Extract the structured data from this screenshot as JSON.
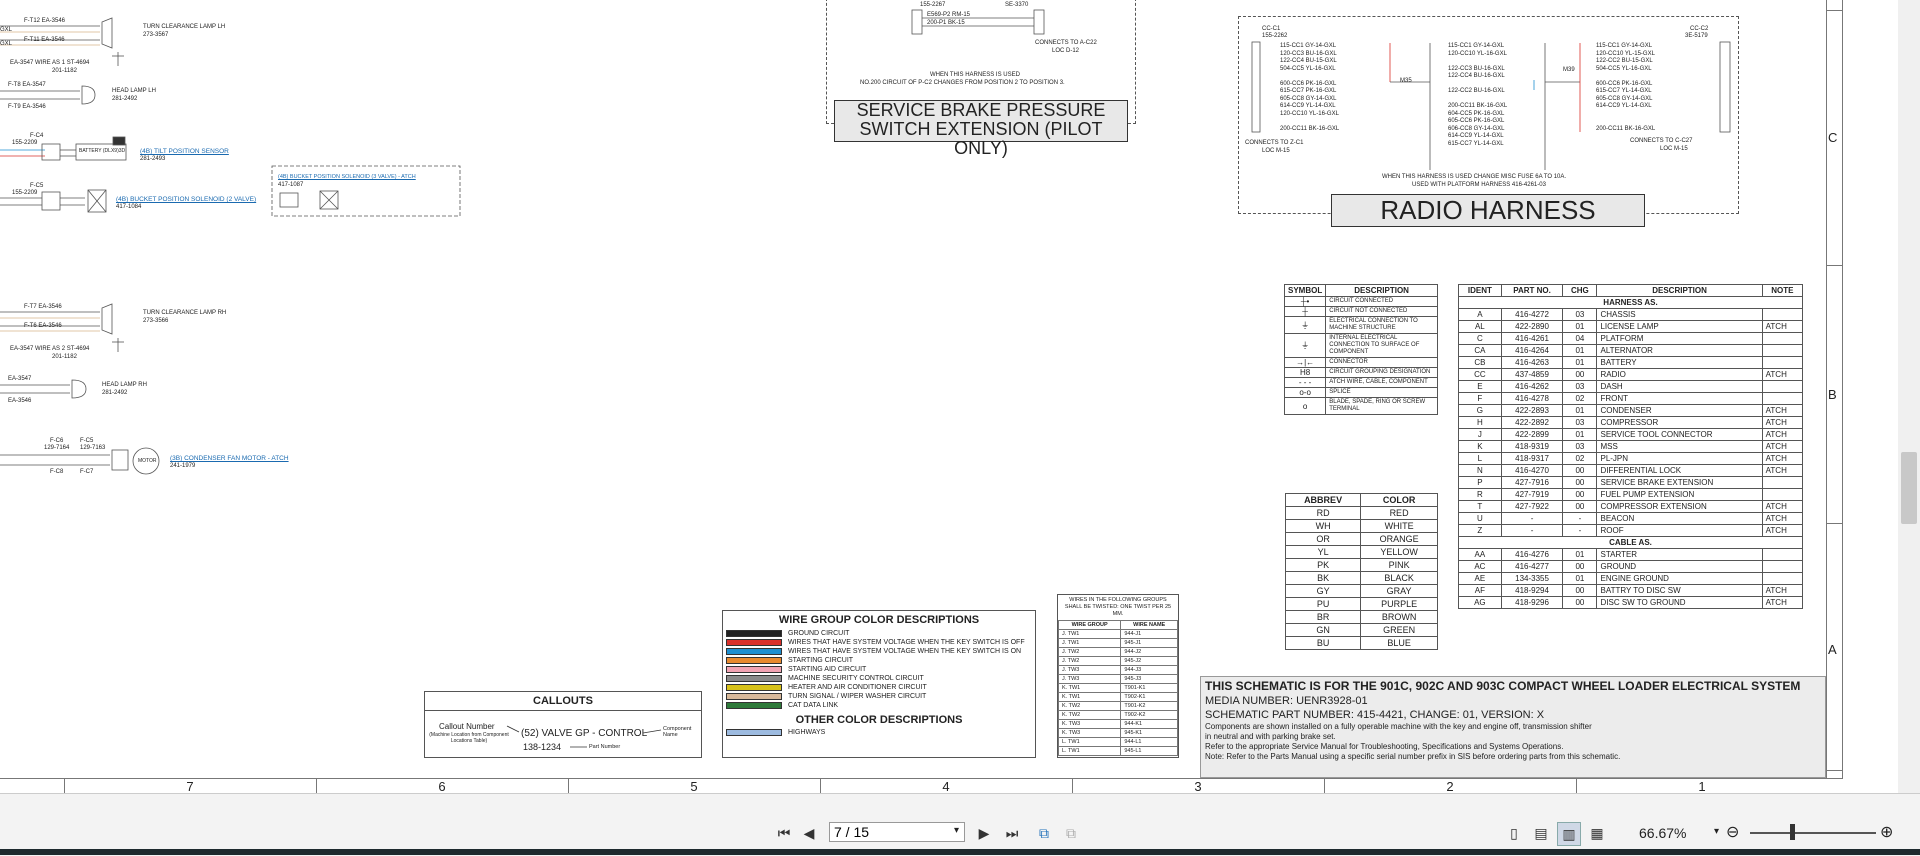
{
  "left_circuits": [
    {
      "id": "a1",
      "wires": [
        "F-T12 EA-3546",
        "F-T11 EA-3546"
      ],
      "left": [
        "GXL",
        "GXL"
      ],
      "under": "EA-3547  WIRE AS 1  ST-4694",
      "part": "201-1182",
      "lamp": "TURN CLEARANCE LAMP LH",
      "lamp_part": "273-3567"
    },
    {
      "id": "a2",
      "wires": [
        "F-T8 EA-3547",
        "F-T9 EA-3546"
      ],
      "lamp": "HEAD LAMP LH",
      "lamp_part": "281-2492"
    },
    {
      "id": "a3",
      "ref": "F-C4",
      "part": "155-2209",
      "box": "BATTERY (DLX9)3D",
      "link": "(4B) TILT POSITION SENSOR",
      "link_part": "281-2493"
    },
    {
      "id": "a4",
      "ref": "F-C5",
      "part": "155-2209",
      "link": "(4B) BUCKET POSITION SOLENOID (2 VALVE)",
      "link_part": "417-1084",
      "atch_title": "(4B) BUCKET POSITION SOLENOID (3 VALVE) - ATCH",
      "atch_part": "417-1087"
    },
    {
      "id": "a5",
      "wires": [
        "F-T7 EA-3546",
        "F-T6 EA-3546"
      ],
      "under": "EA-3547  WIRE AS 2  ST-4694",
      "part": "201-1182",
      "lamp": "TURN CLEARANCE LAMP RH",
      "lamp_part": "273-3566"
    },
    {
      "id": "a6",
      "wires": [
        "EA-3547",
        "EA-3546"
      ],
      "lamp": "HEAD LAMP RH",
      "lamp_part": "281-2492"
    },
    {
      "id": "a7",
      "refs": [
        "F-C6",
        "F-C5",
        "F-C8",
        "F-C7"
      ],
      "parts": [
        "129-7164",
        "129-7163"
      ],
      "link": "(3B) CONDENSER FAN MOTOR - ATCH",
      "link_part": "241-1979",
      "motor": "MOTOR"
    }
  ],
  "brake": {
    "top_parts": [
      "155-2267",
      "SE-3370",
      "E569-P2  RM-15",
      "200-P1  BK-15"
    ],
    "connects": "CONNECTS TO A-C22",
    "loc": "LOC D-12",
    "note1": "WHEN THIS HARNESS IS USED",
    "note2": "NO.200 CIRCUIT OF P-C2 CHANGES FROM POSITION 2 TO POSITION 3.",
    "title_line1": "SERVICE BRAKE PRESSURE",
    "title_line2": "SWITCH EXTENSION (PILOT ONLY)"
  },
  "radio": {
    "left_header": "CC-C1",
    "left_part": "155-2262",
    "left_wires": [
      "115-CC1  GY-14-GXL",
      "120-CC3  BU-16-GXL",
      "122-CC4  BU-15-GXL",
      "504-CC5  YL-16-GXL",
      "",
      "600-CC6  PK-16-GXL",
      "615-CC7  PK-16-GXL",
      "605-CC8  GY-14-GXL",
      "614-CC9  YL-14-GXL",
      "120-CC10  YL-16-GXL",
      "",
      "200-CC11  BK-16-GXL"
    ],
    "mid_wires": [
      "115-CC1  GY-14-GXL",
      "120-CC10  YL-16-GXL",
      "",
      "122-CC3  BU-16-GXL",
      "122-CC4  BU-16-GXL",
      "",
      "122-CC2  BU-16-GXL",
      "",
      "200-CC11  BK-16-GXL",
      "604-CC5  PK-16-GXL",
      "605-CC6  PK-16-GXL",
      "606-CC8  GY-14-GXL",
      "614-CC9  YL-14-GXL",
      "615-CC7  YL-14-GXL"
    ],
    "right_header": "CC-C2",
    "right_part": "3E-5179",
    "right_wires": [
      "115-CC1  GY-14-GXL",
      "120-CC10  YL-15-GXL",
      "122-CC2  BU-15-GXL",
      "504-CC5  YL-16-GXL",
      "",
      "600-CC6  PK-16-GXL",
      "615-CC7  YL-14-GXL",
      "605-CC8  GY-14-GXL",
      "614-CC9  YL-14-GXL",
      "",
      "",
      "200-CC11  BK-16-GXL"
    ],
    "m35": "M35",
    "m39": "M39",
    "connects_left": "CONNECTS TO Z-C1",
    "loc_left": "LOC M-15",
    "connects_right": "CONNECTS TO C-C27",
    "loc_right": "LOC M-15",
    "note1": "WHEN THIS HARNESS IS USED CHANGE MISC FUSE 6A TO 10A.",
    "note2": "USED WITH PLATFORM HARNESS 416-4261-03",
    "title": "RADIO HARNESS"
  },
  "symbols": {
    "headers": [
      "SYMBOL",
      "DESCRIPTION"
    ],
    "rows": [
      {
        "glyph": "┼•",
        "desc": "CIRCUIT CONNECTED"
      },
      {
        "glyph": "┼",
        "desc": "CIRCUIT NOT CONNECTED"
      },
      {
        "glyph": "⏚",
        "desc": "ELECTRICAL CONNECTION TO MACHINE STRUCTURE"
      },
      {
        "glyph": "⏚",
        "desc": "INTERNAL ELECTRICAL CONNECTION TO SURFACE OF COMPONENT"
      },
      {
        "glyph": "→|←",
        "desc": "CONNECTOR"
      },
      {
        "glyph": "H8",
        "desc": "CIRCUIT GROUPING DESIGNATION"
      },
      {
        "glyph": "- - -",
        "desc": "ATCH WIRE, CABLE, COMPONENT"
      },
      {
        "glyph": "o-o",
        "desc": "SPLICE"
      },
      {
        "glyph": "o",
        "desc": "BLADE, SPADE, RING OR SCREW TERMINAL"
      }
    ]
  },
  "abbrev": {
    "headers": [
      "ABBREV",
      "COLOR"
    ],
    "rows": [
      [
        "RD",
        "RED"
      ],
      [
        "WH",
        "WHITE"
      ],
      [
        "OR",
        "ORANGE"
      ],
      [
        "YL",
        "YELLOW"
      ],
      [
        "PK",
        "PINK"
      ],
      [
        "BK",
        "BLACK"
      ],
      [
        "GY",
        "GRAY"
      ],
      [
        "PU",
        "PURPLE"
      ],
      [
        "BR",
        "BROWN"
      ],
      [
        "GN",
        "GREEN"
      ],
      [
        "BU",
        "BLUE"
      ]
    ]
  },
  "harness": {
    "headers": [
      "IDENT",
      "PART NO.",
      "CHG",
      "DESCRIPTION",
      "NOTE"
    ],
    "sections": [
      {
        "title": "HARNESS AS.",
        "rows": [
          [
            "A",
            "416-4272",
            "03",
            "CHASSIS",
            ""
          ],
          [
            "AL",
            "422-2890",
            "01",
            "LICENSE LAMP",
            "ATCH"
          ],
          [
            "C",
            "416-4261",
            "04",
            "PLATFORM",
            ""
          ],
          [
            "CA",
            "416-4264",
            "01",
            "ALTERNATOR",
            ""
          ],
          [
            "CB",
            "416-4263",
            "01",
            "BATTERY",
            ""
          ],
          [
            "CC",
            "437-4859",
            "00",
            "RADIO",
            "ATCH"
          ],
          [
            "E",
            "416-4262",
            "03",
            "DASH",
            ""
          ],
          [
            "F",
            "416-4278",
            "02",
            "FRONT",
            ""
          ],
          [
            "G",
            "422-2893",
            "01",
            "CONDENSER",
            "ATCH"
          ],
          [
            "H",
            "422-2892",
            "03",
            "COMPRESSOR",
            "ATCH"
          ],
          [
            "J",
            "422-2899",
            "01",
            "SERVICE TOOL CONNECTOR",
            "ATCH"
          ],
          [
            "K",
            "418-9319",
            "03",
            "MSS",
            "ATCH"
          ],
          [
            "L",
            "418-9317",
            "02",
            "PL-JPN",
            "ATCH"
          ],
          [
            "N",
            "416-4270",
            "00",
            "DIFFERENTIAL LOCK",
            "ATCH"
          ],
          [
            "P",
            "427-7916",
            "00",
            "SERVICE BRAKE EXTENSION",
            ""
          ],
          [
            "R",
            "427-7919",
            "00",
            "FUEL PUMP EXTENSION",
            ""
          ],
          [
            "T",
            "427-7922",
            "00",
            "COMPRESSOR EXTENSION",
            "ATCH"
          ],
          [
            "U",
            "-",
            "-",
            "BEACON",
            "ATCH"
          ],
          [
            "Z",
            "-",
            "-",
            "ROOF",
            "ATCH"
          ]
        ]
      },
      {
        "title": "CABLE AS.",
        "rows": [
          [
            "AA",
            "416-4276",
            "01",
            "STARTER",
            ""
          ],
          [
            "AC",
            "416-4277",
            "00",
            "GROUND",
            ""
          ],
          [
            "AE",
            "134-3355",
            "01",
            "ENGINE GROUND",
            ""
          ],
          [
            "AF",
            "418-9294",
            "00",
            "BATTRY TO DISC SW",
            "ATCH"
          ],
          [
            "AG",
            "418-9296",
            "00",
            "DISC SW TO GROUND",
            "ATCH"
          ]
        ]
      }
    ]
  },
  "wire_group": {
    "title": "WIRE GROUP COLOR DESCRIPTIONS",
    "rows": [
      {
        "color": "#222222",
        "label": "GROUND CIRCUIT"
      },
      {
        "color": "#d9312b",
        "label": "WIRES THAT HAVE SYSTEM VOLTAGE WHEN THE KEY SWITCH IS OFF"
      },
      {
        "color": "#1e8fd0",
        "label": "WIRES THAT HAVE SYSTEM VOLTAGE WHEN THE KEY SWITCH IS ON"
      },
      {
        "color": "#e88a2e",
        "label": "STARTING CIRCUIT"
      },
      {
        "color": "#f2a3b3",
        "label": "STARTING AID CIRCUIT"
      },
      {
        "color": "#8a8a8a",
        "label": "MACHINE SECURITY CONTROL CIRCUIT"
      },
      {
        "color": "#d8c21a",
        "label": "HEATER AND AIR CONDITIONER CIRCUIT"
      },
      {
        "color": "#d8b99a",
        "label": "TURN SIGNAL / WIPER WASHER CIRCUIT"
      },
      {
        "color": "#2e7a3a",
        "label": "CAT DATA LINK"
      }
    ],
    "other_title": "OTHER COLOR DESCRIPTIONS",
    "other_rows": [
      {
        "color": "#9dbbe0",
        "label": "HIGHWAYS"
      }
    ]
  },
  "twisted": {
    "title": "WIRES IN THE FOLLOWING GROUPS SHALL BE TWISTED: ONE TWIST PER 25 MM.",
    "headers": [
      "WIRE GROUP",
      "WIRE NAME"
    ],
    "rows": [
      [
        "J. TW1",
        "944-J1"
      ],
      [
        "J. TW1",
        "945-J1"
      ],
      [
        "J. TW2",
        "944-J2"
      ],
      [
        "J. TW2",
        "945-J2"
      ],
      [
        "J. TW3",
        "944-J3"
      ],
      [
        "J. TW3",
        "945-J3"
      ],
      [
        "K. TW1",
        "T901-K1"
      ],
      [
        "K. TW1",
        "T902-K1"
      ],
      [
        "K. TW2",
        "T901-K2"
      ],
      [
        "K. TW2",
        "T902-K2"
      ],
      [
        "K. TW3",
        "944-K1"
      ],
      [
        "K. TW3",
        "945-K1"
      ],
      [
        "L. TW1",
        "944-L1"
      ],
      [
        "L. TW1",
        "945-L1"
      ]
    ]
  },
  "callouts": {
    "title": "CALLOUTS",
    "callout_number": "Callout Number",
    "callout_sub": "(Machine Location from Component Locations Table)",
    "example": "(52) VALVE GP - CONTROL",
    "example_part": "138-1234",
    "component": "Component Name",
    "part_number": "Part Number"
  },
  "info": {
    "line1": "THIS SCHEMATIC IS FOR THE 901C, 902C AND 903C COMPACT WHEEL LOADER ELECTRICAL SYSTEM",
    "line2": "MEDIA NUMBER: UENR3928-01",
    "line3": "SCHEMATIC PART NUMBER: 415-4421, CHANGE: 01, VERSION: X",
    "line4": "Components are shown installed on a fully operable machine with the key and engine off, transmission shifter",
    "line5": "in neutral and with parking brake set.",
    "line6": "Refer to the appropriate Service Manual for Troubleshooting, Specifications and Systems Operations.",
    "line7": "Note: Refer to the Parts Manual using a specific serial number prefix in SIS before ordering parts from this schematic."
  },
  "zones_bottom": [
    "7",
    "6",
    "5",
    "4",
    "3",
    "2",
    "1"
  ],
  "zones_right": [
    "C",
    "B",
    "A"
  ],
  "viewer": {
    "page_value": "7 / 15",
    "zoom": "66.67%"
  }
}
